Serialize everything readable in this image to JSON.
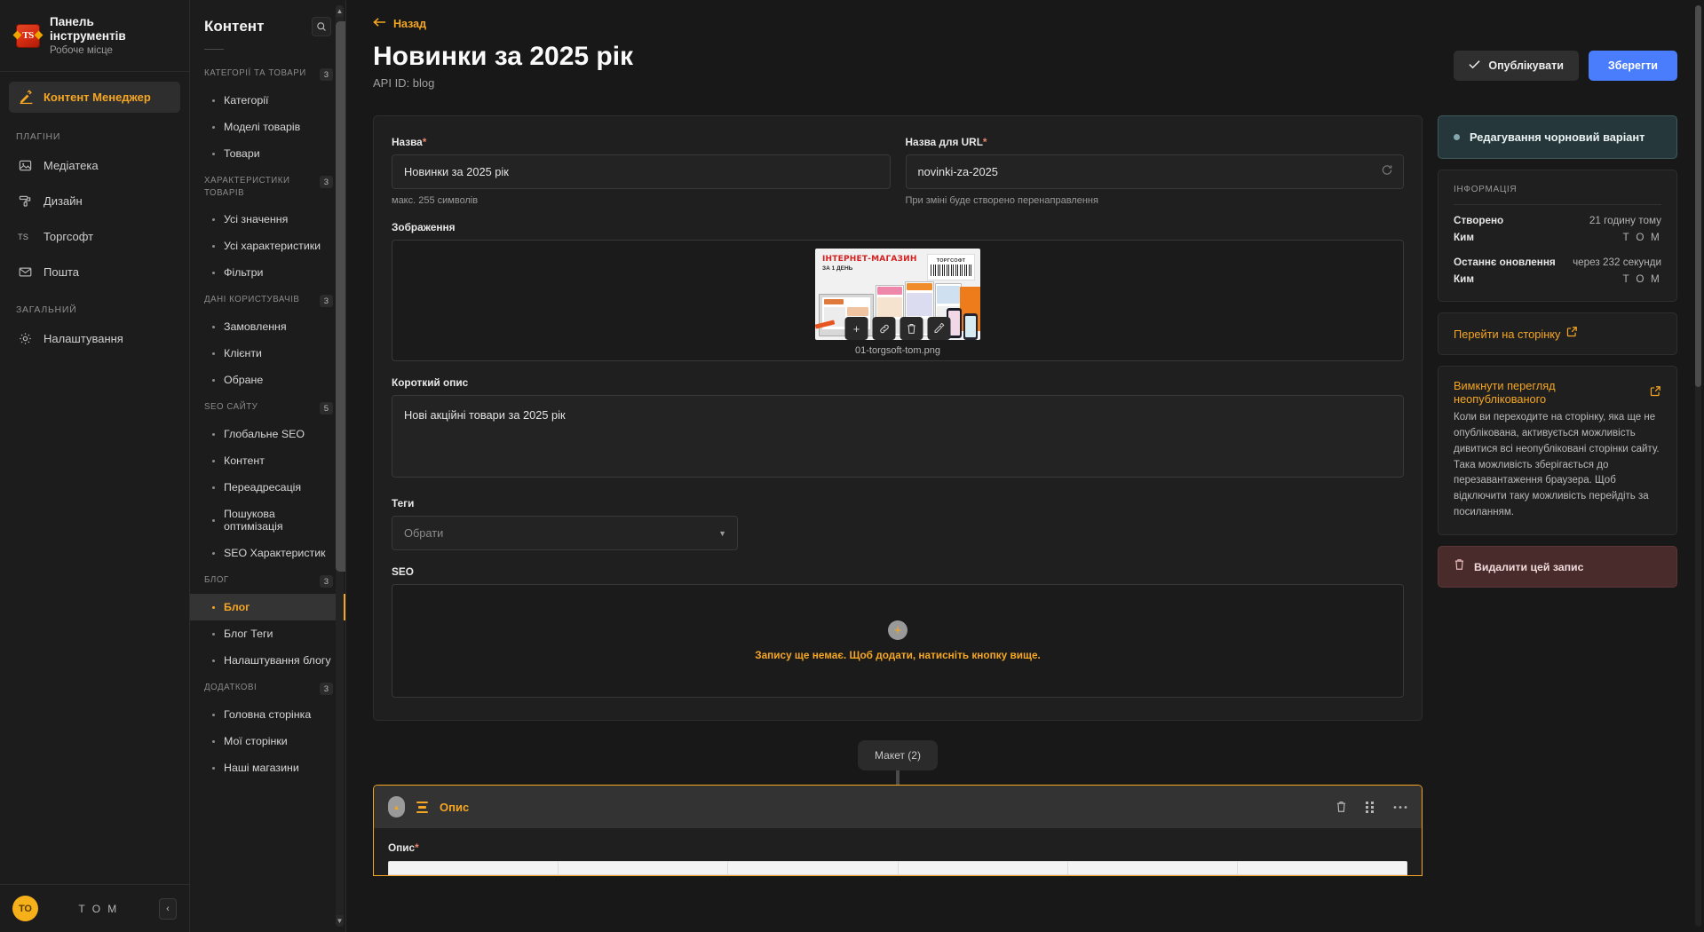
{
  "brand": {
    "logo_text": "TS",
    "title": "Панель інструментів",
    "subtitle": "Робоче місце"
  },
  "left_rail": {
    "active_item": "Контент Менеджер",
    "groups": [
      {
        "title": "ПЛАГІНИ",
        "items": [
          {
            "label": "Медіатека",
            "icon": "image-icon"
          },
          {
            "label": "Дизайн",
            "icon": "paint-roller-icon"
          },
          {
            "label": "Торгсофт",
            "icon": "ts-icon"
          },
          {
            "label": "Пошта",
            "icon": "mail-icon"
          }
        ]
      },
      {
        "title": "ЗАГАЛЬНИЙ",
        "items": [
          {
            "label": "Налаштування",
            "icon": "gear-icon"
          }
        ]
      }
    ],
    "footer": {
      "avatar_initials": "ТО",
      "user": "Т О М",
      "collapse_icon": "chevron-left-icon"
    }
  },
  "content_nav": {
    "title": "Контент",
    "search_icon": "search-icon",
    "sections": [
      {
        "label": "КАТЕГОРІЇ ТА ТОВАРИ",
        "badge": "3",
        "items": [
          {
            "label": "Категорії",
            "active": false
          },
          {
            "label": "Моделі товарів",
            "active": false
          },
          {
            "label": "Товари",
            "active": false
          }
        ]
      },
      {
        "label": "ХАРАКТЕРИСТИКИ ТОВАРІВ",
        "badge": "3",
        "items": [
          {
            "label": "Усі значення",
            "active": false
          },
          {
            "label": "Усі характеристики",
            "active": false
          },
          {
            "label": "Фільтри",
            "active": false
          }
        ]
      },
      {
        "label": "ДАНІ КОРИСТУВАЧІВ",
        "badge": "3",
        "items": [
          {
            "label": "Замовлення",
            "active": false
          },
          {
            "label": "Клієнти",
            "active": false
          },
          {
            "label": "Обране",
            "active": false
          }
        ]
      },
      {
        "label": "SEO САЙТУ",
        "badge": "5",
        "items": [
          {
            "label": "Глобальне SEO",
            "active": false
          },
          {
            "label": "Контент",
            "active": false
          },
          {
            "label": "Переадресація",
            "active": false
          },
          {
            "label": "Пошукова оптимізація",
            "active": false
          },
          {
            "label": "SEO Характеристик",
            "active": false
          }
        ]
      },
      {
        "label": "БЛОГ",
        "badge": "3",
        "items": [
          {
            "label": "Блог",
            "active": true
          },
          {
            "label": "Блог Теги",
            "active": false
          },
          {
            "label": "Налаштування блогу",
            "active": false
          }
        ]
      },
      {
        "label": "ДОДАТКОВІ",
        "badge": "3",
        "items": [
          {
            "label": "Головна сторінка",
            "active": false
          },
          {
            "label": "Мої сторінки",
            "active": false
          },
          {
            "label": "Наші магазини",
            "active": false
          }
        ]
      }
    ]
  },
  "header": {
    "back_label": "Назад",
    "back_icon": "arrow-left-icon",
    "title": "Новинки за 2025 рік",
    "api_id": "API ID: blog",
    "publish_label": "Опублікувати",
    "publish_icon": "check-icon",
    "save_label": "Зберегти"
  },
  "form": {
    "name": {
      "label": "Назва",
      "required": "*",
      "value": "Новинки за 2025 рік",
      "hint": "макс. 255 символів"
    },
    "url": {
      "label": "Назва для URL",
      "required": "*",
      "value": "novinki-za-2025",
      "hint": "При зміні буде створено перенаправлення",
      "icon": "refresh-icon"
    },
    "image": {
      "label": "Зображення",
      "file_name": "01-torgsoft-tom.png",
      "thumb_title": "ІНТЕРНЕТ-МАГАЗИН",
      "thumb_subtitle": "ЗА 1 ДЕНЬ",
      "thumb_badge": "ТОРГСОФТ",
      "actions": [
        {
          "icon": "plus-icon",
          "glyph": "+"
        },
        {
          "icon": "link-icon",
          "glyph": "🔗"
        },
        {
          "icon": "trash-icon",
          "glyph": "🗑"
        },
        {
          "icon": "pencil-icon",
          "glyph": "✎"
        }
      ]
    },
    "short_description": {
      "label": "Короткий опис",
      "value": "Нові акційні товари за 2025 рік"
    },
    "tags": {
      "label": "Теги",
      "placeholder": "Обрати",
      "caret_icon": "chevron-down-icon"
    },
    "seo": {
      "label": "SEO",
      "empty_text": "Запису ще немає. Щоб додати, натисніть кнопку вище.",
      "plus_icon": "plus-icon"
    }
  },
  "right_panel": {
    "status": {
      "text": "Редагування чорновий варіант",
      "dot_color": "#83a7ad"
    },
    "info": {
      "title": "ІНФОРМАЦІЯ",
      "rows": [
        {
          "key": "Створено",
          "value": "21 годину тому",
          "spaced": false
        },
        {
          "key": "Ким",
          "value": "Т О М",
          "spaced": true
        },
        {
          "key": "Останнє оновлення",
          "value": "через 232 секунди",
          "spaced": false
        },
        {
          "key": "Ким",
          "value": "Т О М",
          "spaced": true
        }
      ]
    },
    "goto_page": {
      "label": "Перейти на сторінку",
      "icon": "external-link-icon"
    },
    "preview_note": {
      "title": "Вимкнути перегляд неопублікованого",
      "icon": "external-link-icon",
      "body": "Коли ви переходите на сторінку, яка ще не опублікована, активується можливість дивитися всі неопубліковані сторінки сайту. Така можливість зберігається до перезавантаження браузера. Щоб відключити таку можливість перейдіть за посиланням."
    },
    "delete": {
      "label": "Видалити цей запис",
      "icon": "trash-icon"
    }
  },
  "layout_section": {
    "pill_label": "Макет (2)",
    "panel": {
      "title": "Опис",
      "collapse_icon": "chevron-up-icon",
      "drag_icon": "menu-lines-icon",
      "tools": [
        {
          "icon": "trash-icon"
        },
        {
          "icon": "grid-dots-icon"
        },
        {
          "icon": "more-horizontal-icon"
        }
      ],
      "field_label": "Опис",
      "field_required": "*"
    }
  },
  "colors": {
    "accent": "#f5a623",
    "primary_button": "#4a7dfc",
    "status_card": "#25373a",
    "danger_card": "#4a2b2b",
    "background": "#181818"
  }
}
